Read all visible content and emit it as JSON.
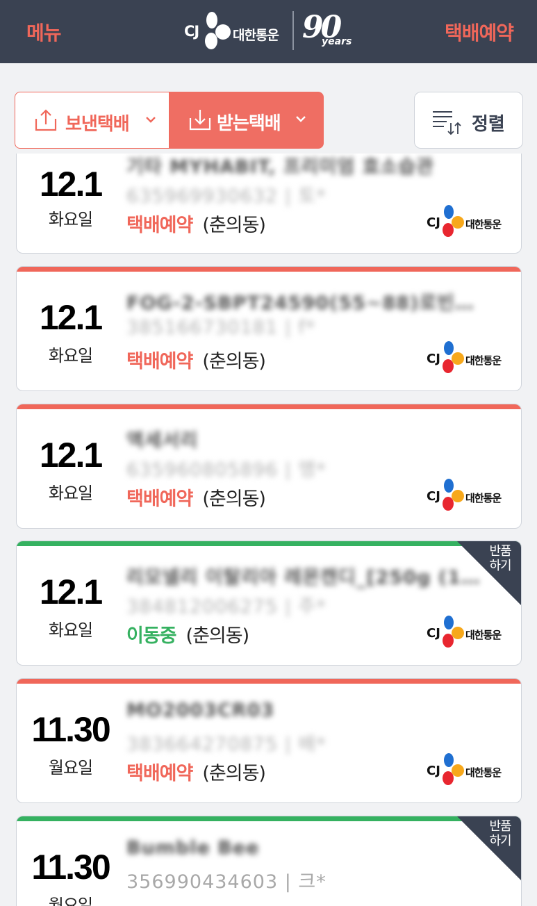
{
  "header": {
    "menu_label": "메뉴",
    "book_label": "택배예약",
    "logo": {
      "cj": "CJ",
      "name": "대한통운",
      "anniversary": "90",
      "years": "years"
    }
  },
  "colors": {
    "header_bg": "#3a4252",
    "accent": "#f0675a",
    "moving": "#35b160",
    "return_tag": "#3a4252"
  },
  "filter": {
    "send_label": "보낸택배",
    "receive_label": "받는택배",
    "active": "receive",
    "sort_label": "정렬"
  },
  "cards": [
    {
      "month_day": "12.1",
      "weekday": "화요일",
      "title": "기타 MYHABIT, 프리미엄 효소습관",
      "tracking": "635969930632 | 토*",
      "status": "택배예약",
      "area": "(춘의동)",
      "bar": "none",
      "return_label": "",
      "brand_cj": "CJ",
      "brand_name": "대한통운"
    },
    {
      "month_day": "12.1",
      "weekday": "화요일",
      "title": "FOG-2-SBPT24590(55~88)로빈…",
      "tracking": "385166730181 | f*",
      "status": "택배예약",
      "area": "(춘의동)",
      "bar": "red",
      "return_label": "",
      "brand_cj": "CJ",
      "brand_name": "대한통운"
    },
    {
      "month_day": "12.1",
      "weekday": "화요일",
      "title": "액세서리",
      "tracking": "635960805896 | 맹*",
      "status": "택배예약",
      "area": "(춘의동)",
      "bar": "red",
      "return_label": "",
      "brand_cj": "CJ",
      "brand_name": "대한통운"
    },
    {
      "month_day": "12.1",
      "weekday": "화요일",
      "title": "리모넬리 이탈리아 레몬캔디_[250g (1…",
      "tracking": "384812006275 | 주*",
      "status": "이동중",
      "area": "(춘의동)",
      "bar": "green",
      "return_label": "반품\n하기",
      "brand_cj": "CJ",
      "brand_name": "대한통운"
    },
    {
      "month_day": "11.30",
      "weekday": "월요일",
      "title": "MO2003CR03",
      "tracking": "383664270875 | 배*",
      "status": "택배예약",
      "area": "(춘의동)",
      "bar": "red",
      "return_label": "",
      "brand_cj": "CJ",
      "brand_name": "대한통운"
    },
    {
      "month_day": "11.30",
      "weekday": "월요일",
      "title": "Bumble Bee",
      "tracking": "356990434603 | 크*",
      "status": "",
      "area": "",
      "bar": "green",
      "return_label": "반품\n하기",
      "brand_cj": "CJ",
      "brand_name": "대한통운"
    }
  ]
}
